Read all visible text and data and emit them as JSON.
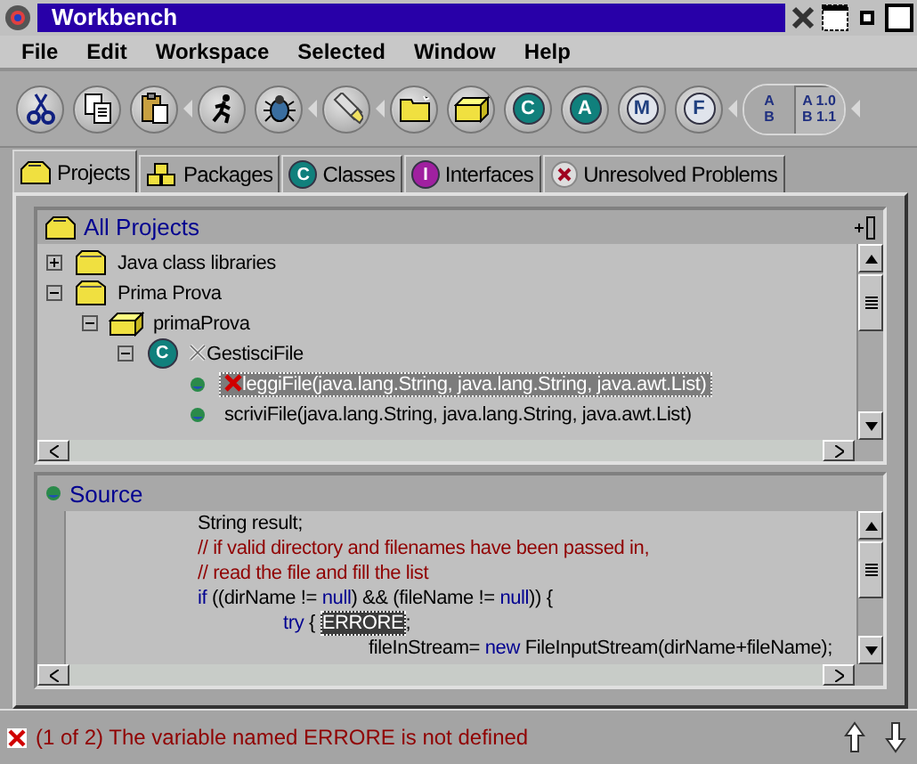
{
  "window": {
    "title": "Workbench"
  },
  "menu": [
    "File",
    "Edit",
    "Workspace",
    "Selected",
    "Window",
    "Help"
  ],
  "toolbar": [
    [
      {
        "kind": "cut"
      },
      {
        "kind": "copy"
      },
      {
        "kind": "paste"
      }
    ],
    [
      {
        "kind": "run"
      },
      {
        "kind": "debug"
      }
    ],
    [
      {
        "kind": "flashlight"
      }
    ],
    [
      {
        "kind": "folder"
      },
      {
        "kind": "package"
      },
      {
        "kind": "badge",
        "label": "C",
        "color": "#10807c"
      },
      {
        "kind": "badge",
        "label": "A",
        "color": "#10807c"
      },
      {
        "kind": "badge",
        "label": "M",
        "color": "#e0e4ec"
      },
      {
        "kind": "badge",
        "label": "F",
        "color": "#e0e4ec"
      }
    ],
    [
      {
        "kind": "toggle",
        "lines": [
          "A",
          "B"
        ],
        "selected": false
      },
      {
        "kind": "toggle",
        "lines": [
          "A 1.0",
          "B 1.1"
        ],
        "selected": true
      }
    ]
  ],
  "tabs": [
    {
      "label": "Projects",
      "kind": "folder",
      "selected": true
    },
    {
      "label": "Packages",
      "kind": "packages",
      "selected": false
    },
    {
      "label": "Classes",
      "kind": "badge",
      "badge": "C",
      "color": "#10807c",
      "selected": false
    },
    {
      "label": "Interfaces",
      "kind": "badge",
      "badge": "I",
      "color": "#a020a0",
      "selected": false
    },
    {
      "label": "Unresolved Problems",
      "kind": "problem",
      "selected": false
    }
  ],
  "projects": {
    "title": "All Projects",
    "tree": [
      {
        "label": "Java class libraries",
        "kind": "project",
        "expanded": false,
        "selected": false,
        "error": false,
        "inherited_error": false
      },
      {
        "label": "Prima Prova",
        "kind": "project",
        "expanded": true,
        "selected": false,
        "error": false,
        "inherited_error": false,
        "children": [
          {
            "label": "primaProva",
            "kind": "package",
            "expanded": true,
            "selected": false,
            "error": false,
            "inherited_error": false,
            "children": [
              {
                "label": "GestisciFile",
                "kind": "badge",
                "badge": "C",
                "color": "#10807c",
                "expanded": true,
                "selected": false,
                "error": false,
                "inherited_error": true,
                "children": [
                  {
                    "label": "leggiFile(java.lang.String, java.lang.String, java.awt.List)",
                    "kind": "method",
                    "selected": true,
                    "error": true,
                    "inherited_error": false
                  },
                  {
                    "label": "scriviFile(java.lang.String, java.lang.String, java.awt.List)",
                    "kind": "method",
                    "selected": false,
                    "error": false,
                    "inherited_error": false
                  }
                ]
              }
            ]
          }
        ]
      }
    ]
  },
  "source": {
    "title": "Source",
    "lines": [
      [
        {
          "kind": "plain",
          "text": "\t\t\tString result;"
        }
      ],
      [
        {
          "kind": "comment",
          "text": "\t\t\t// if valid directory and filenames have been passed in,"
        }
      ],
      [
        {
          "kind": "comment",
          "text": "\t\t\t// read the file and fill the list"
        }
      ],
      [
        {
          "kind": "keyword",
          "text": "\t\t\tif"
        },
        {
          "kind": "plain",
          "text": " ((dirName != "
        },
        {
          "kind": "keyword",
          "text": "null"
        },
        {
          "kind": "plain",
          "text": ") && (fileName != "
        },
        {
          "kind": "keyword",
          "text": "null"
        },
        {
          "kind": "plain",
          "text": ")) {"
        }
      ],
      [
        {
          "kind": "keyword",
          "text": "\t\t\t\t\ttry"
        },
        {
          "kind": "plain",
          "text": " { "
        },
        {
          "kind": "error",
          "text": "ERRORE"
        },
        {
          "kind": "plain",
          "text": ";"
        }
      ],
      [
        {
          "kind": "plain",
          "text": "\t\t\t\t\t\t\tfileInStream= "
        },
        {
          "kind": "keyword",
          "text": "new"
        },
        {
          "kind": "plain",
          "text": " FileInputStream(dirName+fileName);"
        }
      ]
    ]
  },
  "status": {
    "message": "(1 of 2) The variable named ERRORE is not defined"
  }
}
